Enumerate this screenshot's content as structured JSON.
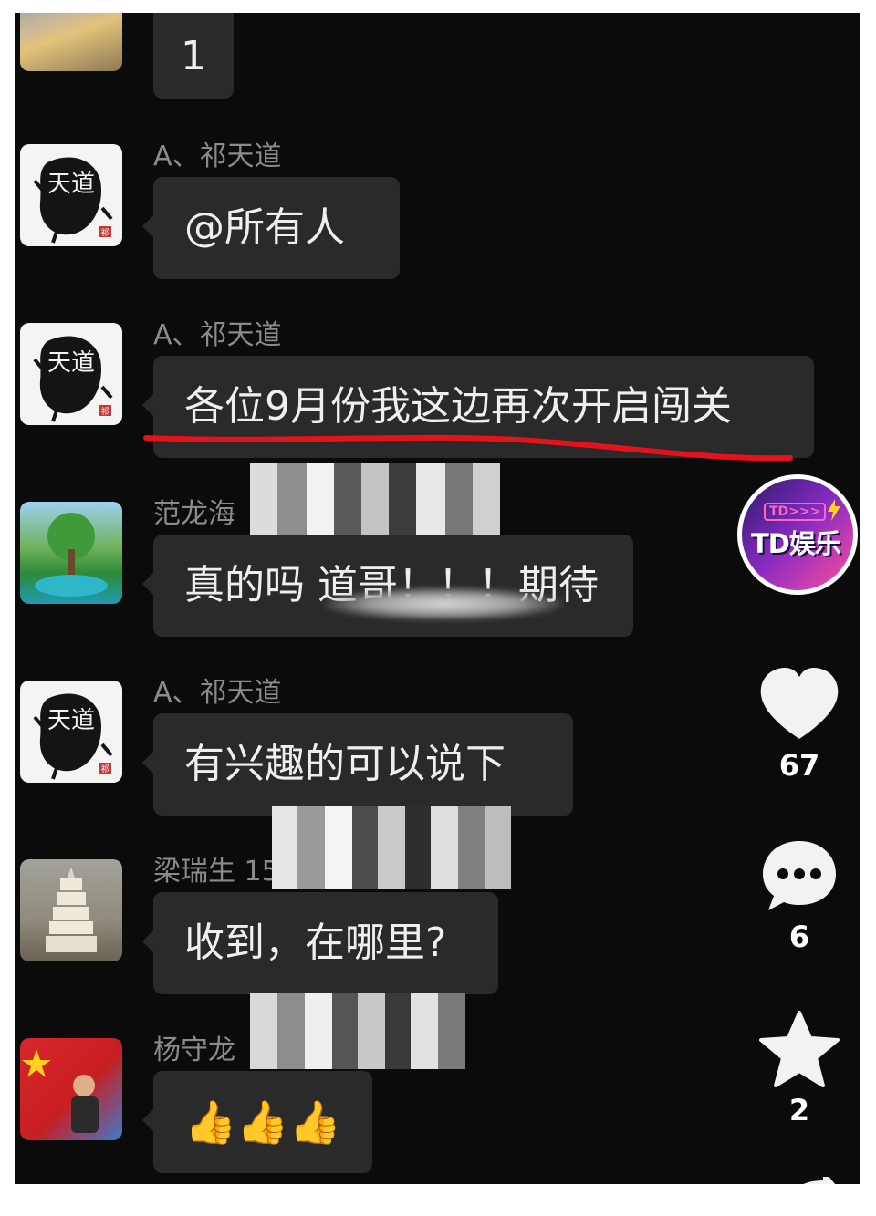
{
  "messages": [
    {
      "text": "1"
    },
    {
      "sender": "A、祁天道",
      "text": "@所有人"
    },
    {
      "sender": "A、祁天道",
      "text": "各位9月份我这边再次开启闯关"
    },
    {
      "sender": "范龙海",
      "text": "真的吗  道哥！！！期待"
    },
    {
      "sender": "A、祁天道",
      "text": "有兴趣的可以说下"
    },
    {
      "sender": "梁瑞生 15",
      "text": "收到，在哪里?"
    },
    {
      "sender": "杨守龙",
      "text": "👍👍👍"
    }
  ],
  "avatar_text": {
    "ink": "天道",
    "seal": "祁"
  },
  "brand": {
    "name": "TD娱乐",
    "tag": "TD>>>"
  },
  "actions": {
    "like": {
      "icon": "heart-icon",
      "count": "67"
    },
    "comment": {
      "icon": "comment-icon",
      "count": "6"
    },
    "favorite": {
      "icon": "star-icon",
      "count": "2"
    },
    "share": {
      "icon": "share-icon"
    }
  },
  "colors": {
    "highlight_underline": "#e3121b",
    "bubble": "#2a2a2a",
    "background": "#0b0b0b"
  }
}
